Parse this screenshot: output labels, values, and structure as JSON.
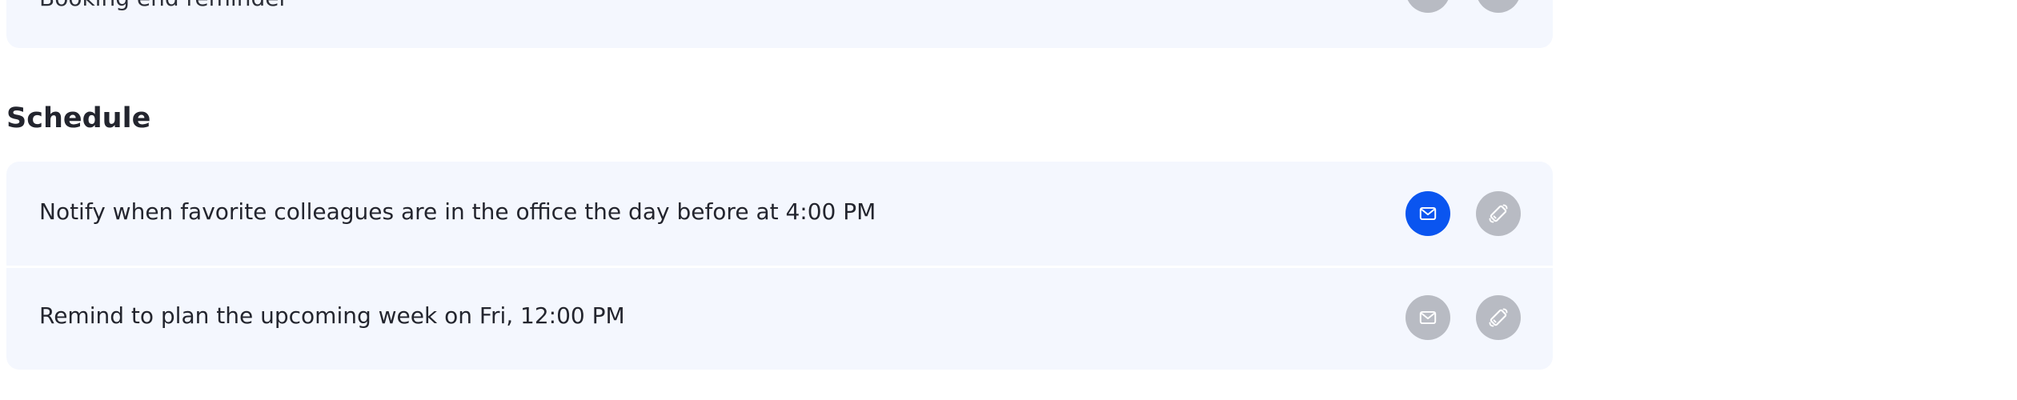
{
  "top_card": {
    "row_label": "Booking end reminder",
    "email_active": false,
    "push_active": false
  },
  "schedule": {
    "title": "Schedule",
    "rows": [
      {
        "label": "Notify when favorite colleagues are in the office the day before at 4:00 PM",
        "email_active": true,
        "push_active": false
      },
      {
        "label": "Remind to plan the upcoming week on Fri, 12:00 PM",
        "email_active": false,
        "push_active": false
      }
    ]
  },
  "icons": {
    "email": "envelope-icon",
    "push": "phone-vibrate-icon"
  },
  "colors": {
    "active": "#0a55f0",
    "inactive": "#b8bbc3",
    "card_background": "#f4f7fe",
    "text": "#23252e"
  }
}
